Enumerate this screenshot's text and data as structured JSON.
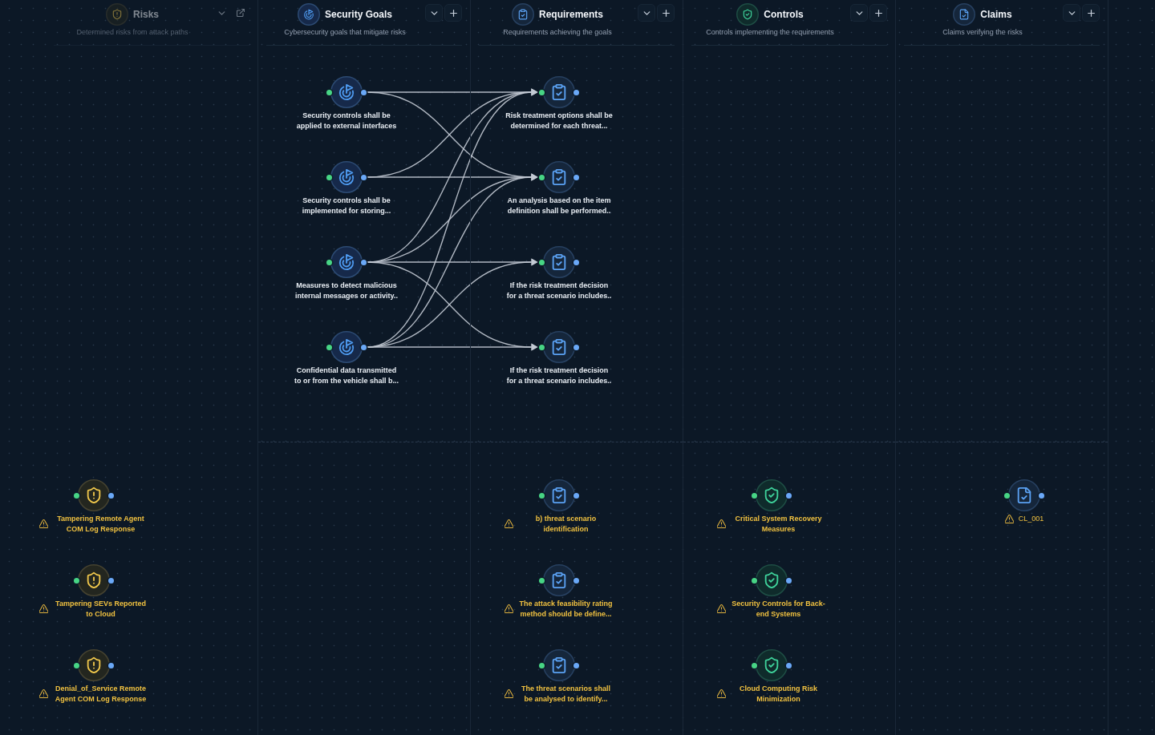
{
  "columns": [
    {
      "kind": "risk",
      "title": "Risks",
      "subtitle": "Determined risks from attack paths",
      "disabled": true,
      "unlinked_nodes": [
        {
          "label": "Tampering Remote Agent COM Log Response",
          "warning": true
        },
        {
          "label": "Tampering SEVs Reported to Cloud",
          "warning": true
        },
        {
          "label": "Denial_of_Service Remote Agent COM Log Response",
          "warning": true
        }
      ]
    },
    {
      "kind": "goal",
      "title": "Security Goals",
      "subtitle": "Cybersecurity goals that mitigate risks",
      "disabled": false,
      "linked_nodes": [
        {
          "label": "Security controls shall be applied to external interfaces",
          "warning": false,
          "links": [
            true,
            true,
            false,
            false
          ]
        },
        {
          "label": "Security controls shall be implemented for storing...",
          "warning": false,
          "links": [
            true,
            true,
            false,
            false
          ]
        },
        {
          "label": "Measures to detect malicious internal messages or activity..",
          "warning": false,
          "links": [
            true,
            true,
            true,
            true
          ]
        },
        {
          "label": "Confidential data transmitted to or from the vehicle shall b...",
          "warning": false,
          "links": [
            true,
            true,
            true,
            true
          ]
        }
      ]
    },
    {
      "kind": "requirement",
      "title": "Requirements",
      "subtitle": "Requirements achieving the goals",
      "disabled": false,
      "linked_nodes": [
        {
          "label": "Risk treatment options shall be determined for each threat...",
          "warning": false
        },
        {
          "label": "An analysis based on the item definition shall be performed..",
          "warning": false
        },
        {
          "label": "If the risk treatment decision for a threat scenario includes..",
          "warning": false
        },
        {
          "label": "If the risk treatment decision for a threat scenario includes..",
          "warning": false
        }
      ],
      "unlinked_nodes": [
        {
          "label": "b) threat scenario identification",
          "warning": true
        },
        {
          "label": "The attack feasibility rating method should be define...",
          "warning": true
        },
        {
          "label": "The threat scenarios shall be analysed to identify...",
          "warning": true
        }
      ]
    },
    {
      "kind": "control",
      "title": "Controls",
      "subtitle": "Controls implementing the requirements",
      "disabled": false,
      "unlinked_nodes": [
        {
          "label": "Critical System Recovery Measures",
          "warning": true
        },
        {
          "label": "Security Controls for Back-end Systems",
          "warning": true
        },
        {
          "label": "Cloud Computing Risk Minimization",
          "warning": true
        }
      ]
    },
    {
      "kind": "claim",
      "title": "Claims",
      "subtitle": "Claims verifying the risks",
      "disabled": false,
      "unlinked_nodes": [
        {
          "label": "CL_001",
          "warning": true
        }
      ]
    }
  ]
}
